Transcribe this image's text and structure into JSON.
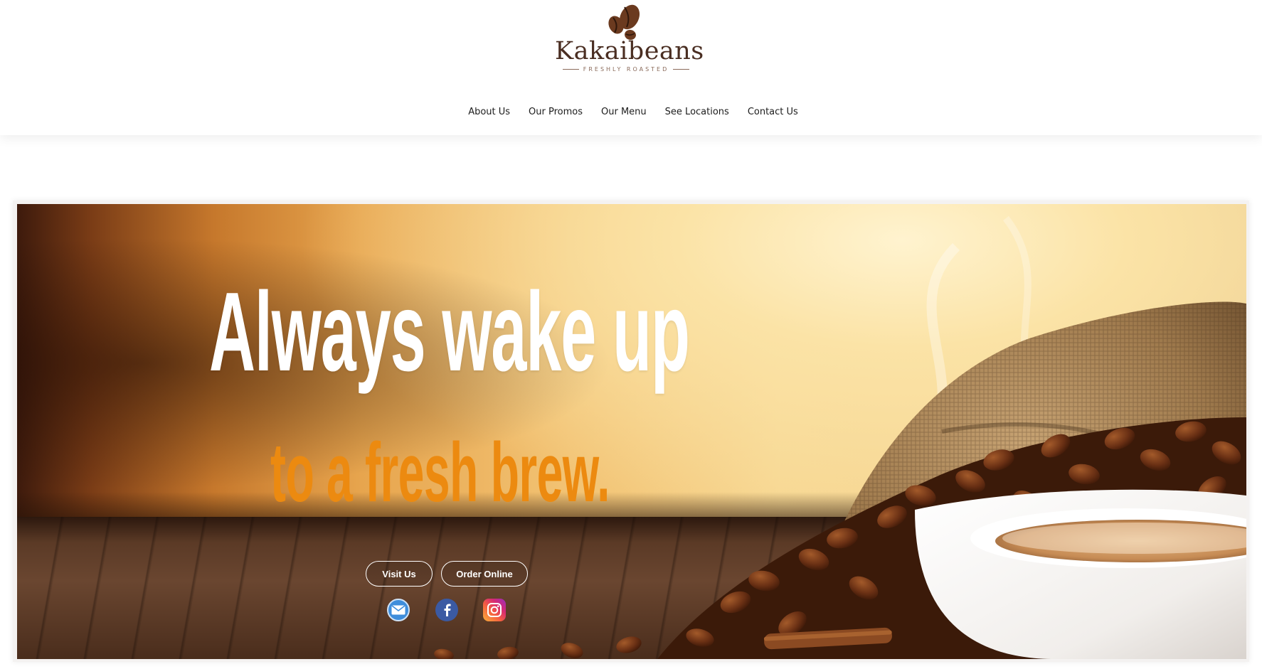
{
  "brand": {
    "name": "Kakaibeans",
    "tagline": "FRESHLY ROASTED"
  },
  "nav": {
    "items": [
      {
        "label": "About Us"
      },
      {
        "label": "Our Promos"
      },
      {
        "label": "Our Menu"
      },
      {
        "label": "See Locations"
      },
      {
        "label": "Contact Us"
      }
    ]
  },
  "hero": {
    "headline": "Always wake up",
    "subline": "to a fresh brew.",
    "buttons": {
      "visit": "Visit Us",
      "order": "Order Online"
    },
    "social": [
      "email-icon",
      "facebook-icon",
      "instagram-icon"
    ]
  },
  "colors": {
    "brand_brown": "#4a2e22",
    "accent_orange": "#ec8a10",
    "facebook_blue": "#3b5aa3",
    "mail_blue": "#3e8ddb"
  }
}
